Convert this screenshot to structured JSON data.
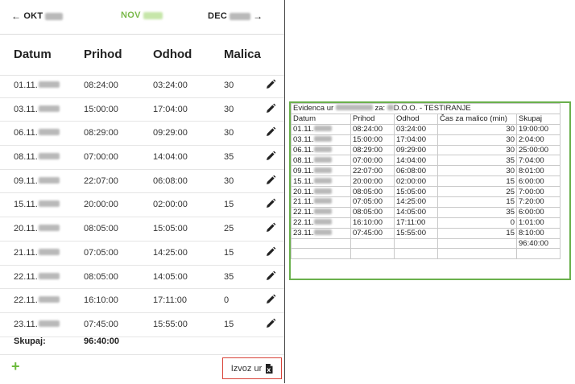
{
  "nav": {
    "prev_label": "OKT",
    "current_label": "NOV",
    "next_label": "DEC",
    "prev_arrow": "←",
    "next_arrow": "→"
  },
  "table": {
    "headers": [
      "Datum",
      "Prihod",
      "Odhod",
      "Malica"
    ],
    "rows": [
      {
        "date": "01.11.",
        "in": "08:24:00",
        "out": "03:24:00",
        "break": "30"
      },
      {
        "date": "03.11.",
        "in": "15:00:00",
        "out": "17:04:00",
        "break": "30"
      },
      {
        "date": "06.11.",
        "in": "08:29:00",
        "out": "09:29:00",
        "break": "30"
      },
      {
        "date": "08.11.",
        "in": "07:00:00",
        "out": "14:04:00",
        "break": "35"
      },
      {
        "date": "09.11.",
        "in": "22:07:00",
        "out": "06:08:00",
        "break": "30"
      },
      {
        "date": "15.11.",
        "in": "20:00:00",
        "out": "02:00:00",
        "break": "15"
      },
      {
        "date": "20.11.",
        "in": "08:05:00",
        "out": "15:05:00",
        "break": "25"
      },
      {
        "date": "21.11.",
        "in": "07:05:00",
        "out": "14:25:00",
        "break": "15"
      },
      {
        "date": "22.11.",
        "in": "08:05:00",
        "out": "14:05:00",
        "break": "35"
      },
      {
        "date": "22.11.",
        "in": "16:10:00",
        "out": "17:11:00",
        "break": "0"
      },
      {
        "date": "23.11.",
        "in": "07:45:00",
        "out": "15:55:00",
        "break": "15"
      }
    ],
    "sum_label": "Skupaj:",
    "sum_value": "96:40:00"
  },
  "footer": {
    "add_label": "+",
    "export_label": "Izvoz ur"
  },
  "sheet": {
    "title_prefix": "Evidenca ur",
    "title_mid": "za:",
    "title_company": "D.O.O. - TESTIRANJE",
    "headers": [
      "Datum",
      "Prihod",
      "Odhod",
      "Čas za malico (min)",
      "Skupaj"
    ],
    "rows": [
      {
        "date": "01.11.",
        "in": "08:24:00",
        "out": "03:24:00",
        "break": "30",
        "total": "19:00:00"
      },
      {
        "date": "03.11.",
        "in": "15:00:00",
        "out": "17:04:00",
        "break": "30",
        "total": "2:04:00"
      },
      {
        "date": "06.11.",
        "in": "08:29:00",
        "out": "09:29:00",
        "break": "30",
        "total": "25:00:00"
      },
      {
        "date": "08.11.",
        "in": "07:00:00",
        "out": "14:04:00",
        "break": "35",
        "total": "7:04:00"
      },
      {
        "date": "09.11.",
        "in": "22:07:00",
        "out": "06:08:00",
        "break": "30",
        "total": "8:01:00"
      },
      {
        "date": "15.11.",
        "in": "20:00:00",
        "out": "02:00:00",
        "break": "15",
        "total": "6:00:00"
      },
      {
        "date": "20.11.",
        "in": "08:05:00",
        "out": "15:05:00",
        "break": "25",
        "total": "7:00:00"
      },
      {
        "date": "21.11.",
        "in": "07:05:00",
        "out": "14:25:00",
        "break": "15",
        "total": "7:20:00"
      },
      {
        "date": "22.11.",
        "in": "08:05:00",
        "out": "14:05:00",
        "break": "35",
        "total": "6:00:00"
      },
      {
        "date": "22.11.",
        "in": "16:10:00",
        "out": "17:11:00",
        "break": "0",
        "total": "1:01:00"
      },
      {
        "date": "23.11.",
        "in": "07:45:00",
        "out": "15:55:00",
        "break": "15",
        "total": "8:10:00"
      }
    ],
    "grand_total": "96:40:00"
  },
  "colors": {
    "accent_green": "#7ab94a",
    "plus_green": "#6cba3c",
    "export_border": "#d9443a",
    "sheet_border": "#6ab04c"
  },
  "icons": {
    "row_edit": "pencil-icon",
    "export": "excel-file-icon"
  }
}
